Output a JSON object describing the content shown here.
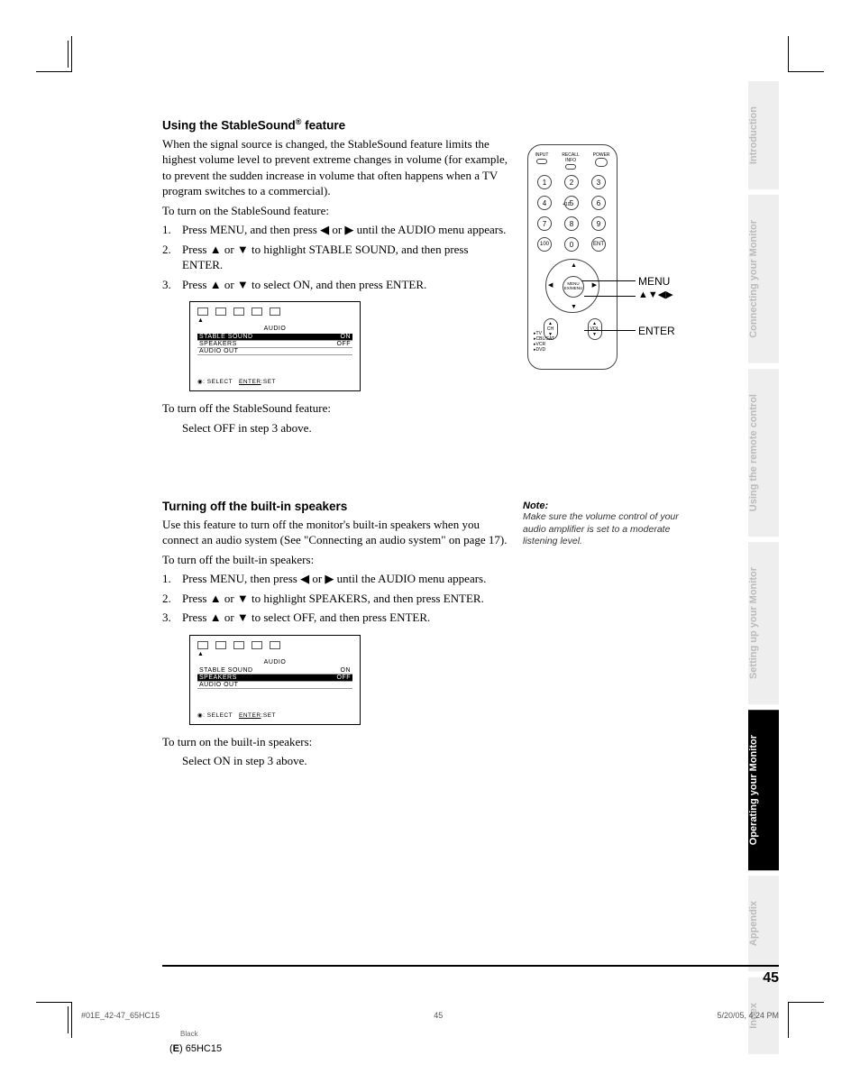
{
  "section1": {
    "heading_a": "Using the StableSound",
    "heading_sup": "®",
    "heading_b": " feature",
    "intro": "When the signal source is changed, the StableSound feature limits the highest volume level to prevent extreme changes in volume (for example, to prevent the sudden increase in volume that often happens when a TV program switches to a commercial).",
    "turn_on": "To turn on the StableSound feature:",
    "step1": "Press MENU, and then press ◀ or ▶ until the AUDIO menu appears.",
    "step2": "Press ▲ or ▼ to highlight STABLE SOUND, and then press ENTER.",
    "step3": "Press ▲ or ▼ to select ON, and then press ENTER.",
    "turn_off": "To turn off the StableSound feature:",
    "turn_off_step": "Select OFF in step 3 above."
  },
  "section2": {
    "heading": "Turning off the built-in speakers",
    "intro": "Use this feature to turn off the monitor's built-in speakers when you connect an audio system (See \"Connecting an audio system\" on page 17).",
    "turn_off": "To turn off the built-in speakers:",
    "step1": "Press MENU, then press ◀ or ▶ until the AUDIO menu appears.",
    "step2": "Press ▲ or ▼ to highlight SPEAKERS, and then press ENTER.",
    "step3": "Press ▲ or ▼ to select OFF, and then press ENTER.",
    "turn_on": "To turn on the built-in speakers:",
    "turn_on_step": "Select ON in step 3 above."
  },
  "osd": {
    "title": "AUDIO",
    "rows": [
      "STABLE SOUND",
      "SPEAKERS",
      "AUDIO OUT"
    ],
    "on": "ON",
    "off": "OFF",
    "footer_select": ": SELECT",
    "footer_enter": "ENTER",
    "footer_set": ":SET"
  },
  "remote": {
    "top": {
      "input": "INPUT",
      "recall": "RECALL",
      "info": "INFO",
      "power": "POWER"
    },
    "keys": [
      "1",
      "2",
      "3",
      "4",
      "5",
      "6",
      "7",
      "8",
      "9",
      "100",
      "0",
      "ENT"
    ],
    "plus10": "+10",
    "center": "MENU\nEX/MENU",
    "ch": "CH",
    "vol": "VOL",
    "side": [
      "TV",
      "CBL/SAT",
      "VCR",
      "DVD"
    ]
  },
  "remote_labels": {
    "menu": "MENU",
    "arrows": "▲▼◀▶",
    "enter": "ENTER"
  },
  "note": {
    "h": "Note:",
    "t": "Make sure the volume control of your audio amplifier is set to a moderate listening level."
  },
  "tabs": [
    "Introduction",
    "Connecting your Monitor",
    "Using the remote control",
    "Setting up your Monitor",
    "Operating your Monitor",
    "Appendix",
    "Index"
  ],
  "active_tab_index": 4,
  "page_number": "45",
  "footer": {
    "file": "#01E_42-47_65HC15",
    "pg": "45",
    "date": "5/20/05, 4:24 PM",
    "black": "Black",
    "model_a": "(",
    "model_b": "E",
    "model_c": ") 65HC15"
  }
}
